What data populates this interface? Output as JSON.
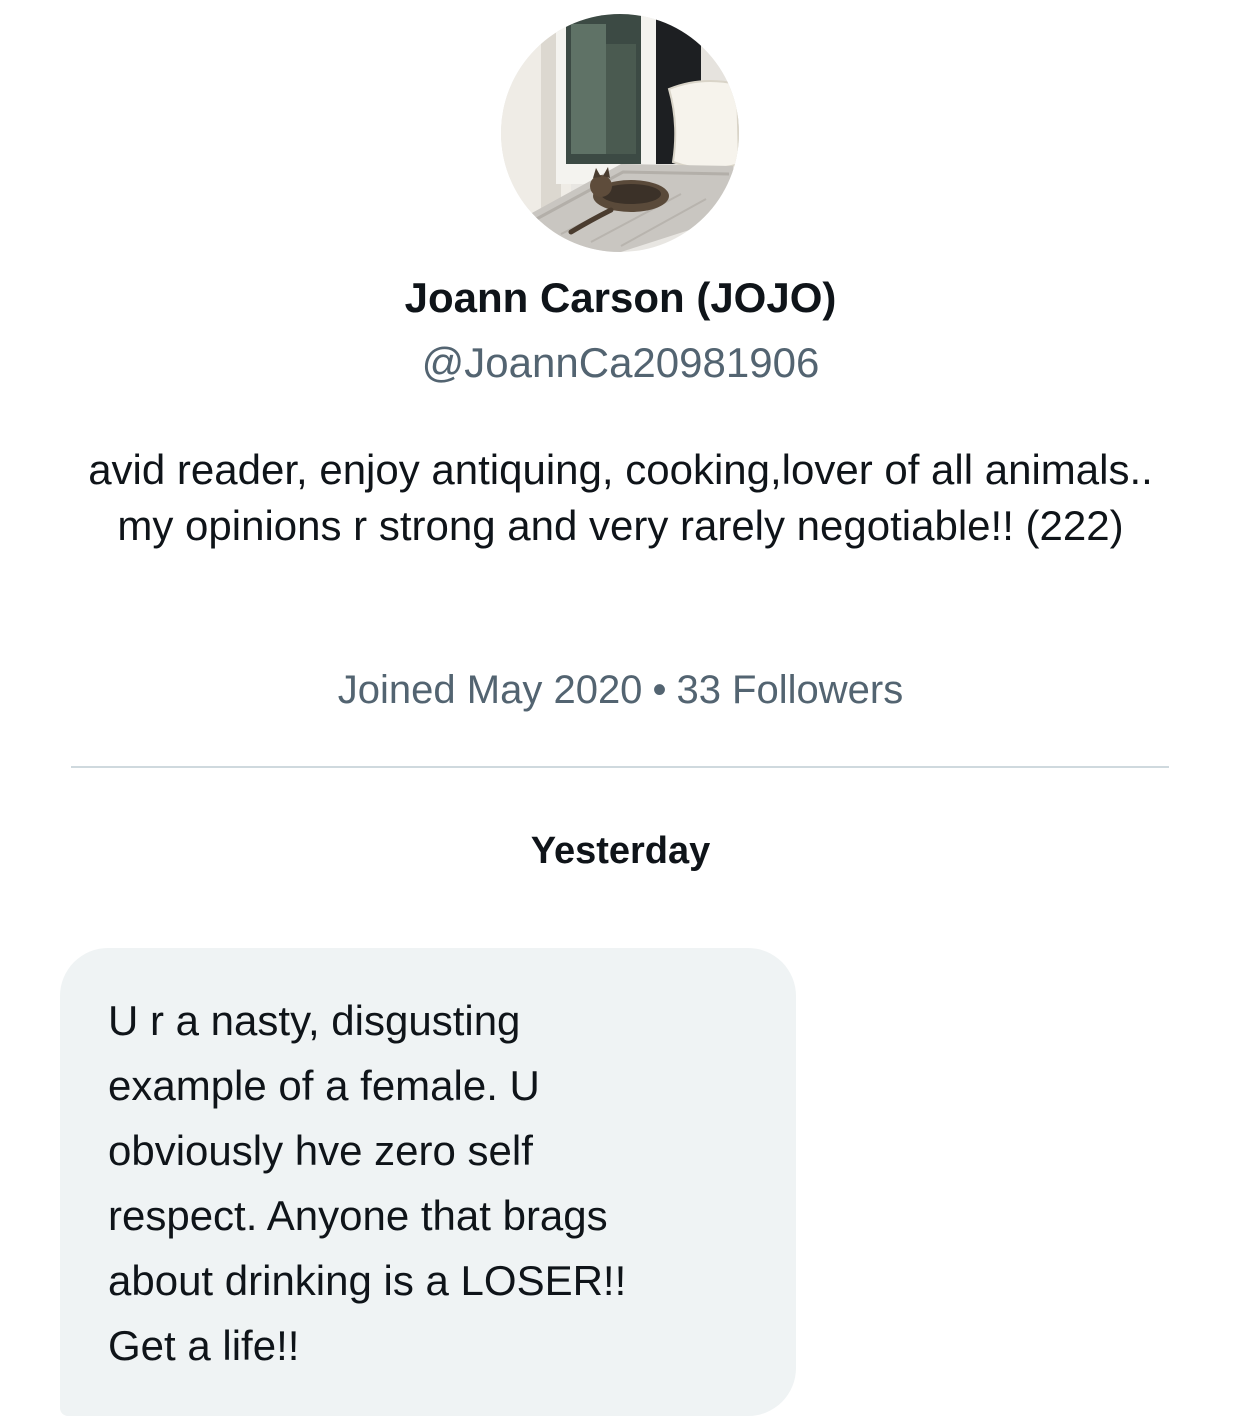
{
  "profile": {
    "avatar_icon": "cat-on-window-seat-avatar",
    "display_name": "Joann Carson (JOJO)",
    "handle": "@JoannCa20981906",
    "bio": "avid reader, enjoy antiquing, cooking,lover of all animals.. my opinions r strong and very rarely negotiable!! (222)",
    "joined": "Joined May 2020",
    "separator": "•",
    "followers": "33 Followers"
  },
  "conversation": {
    "date_header": "Yesterday",
    "messages": [
      {
        "text": "U r a nasty, disgusting\nexample of a female. U\nobviously hve zero self\nrespect.  Anyone that brags\nabout drinking is a LOSER!!\nGet a life!!"
      }
    ]
  },
  "colors": {
    "primary_text": "#0f1419",
    "secondary_text": "#536471",
    "divider": "#cfd9de",
    "bubble_bg": "#eff3f4"
  }
}
